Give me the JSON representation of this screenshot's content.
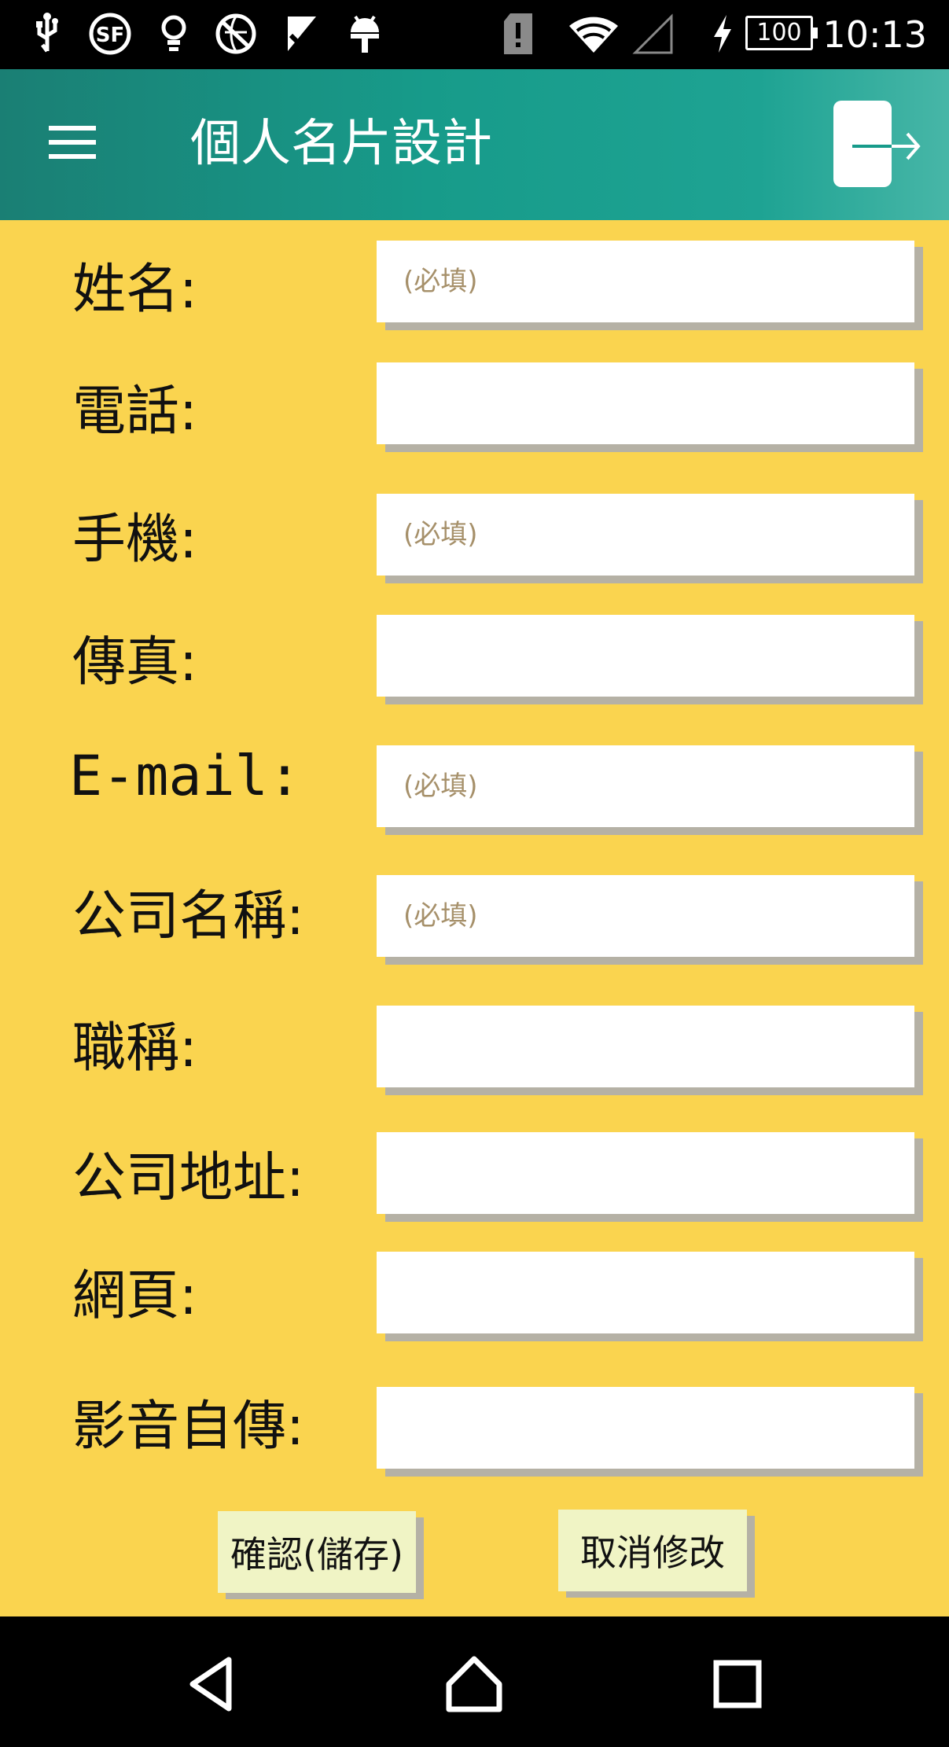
{
  "status_bar": {
    "time": "10:13",
    "battery_level": "100",
    "icons": [
      "usb-icon",
      "sf-icon",
      "bulb-icon",
      "no-globe-icon",
      "check-flag-icon",
      "android-icon",
      "sim-alert-icon",
      "wifi-icon",
      "signal-icon",
      "charging-icon",
      "battery-icon"
    ]
  },
  "app_bar": {
    "title": "個人名片設計",
    "menu_icon": "hamburger-menu-icon",
    "action_icon": "logout-icon"
  },
  "form": {
    "fields": [
      {
        "label": "姓名:",
        "placeholder": "(必填)",
        "value": ""
      },
      {
        "label": "電話:",
        "placeholder": "",
        "value": ""
      },
      {
        "label": "手機:",
        "placeholder": "(必填)",
        "value": ""
      },
      {
        "label": "傳真:",
        "placeholder": "",
        "value": ""
      },
      {
        "label": "E-mail:",
        "placeholder": "(必填)",
        "value": ""
      },
      {
        "label": "公司名稱:",
        "placeholder": "(必填)",
        "value": ""
      },
      {
        "label": "職稱:",
        "placeholder": "",
        "value": ""
      },
      {
        "label": "公司地址:",
        "placeholder": "",
        "value": ""
      },
      {
        "label": "網頁:",
        "placeholder": "",
        "value": ""
      },
      {
        "label": "影音自傳:",
        "placeholder": "",
        "value": ""
      }
    ],
    "confirm_button": "確認(儲存)",
    "cancel_button": "取消修改"
  },
  "nav_bar": {
    "back_icon": "back-triangle-icon",
    "home_icon": "home-icon",
    "recents_icon": "recents-square-icon"
  },
  "colors": {
    "app_bar": "#179b8a",
    "form_background": "#fad44f",
    "button_background": "#f0f4c5",
    "placeholder": "#a6906a"
  }
}
